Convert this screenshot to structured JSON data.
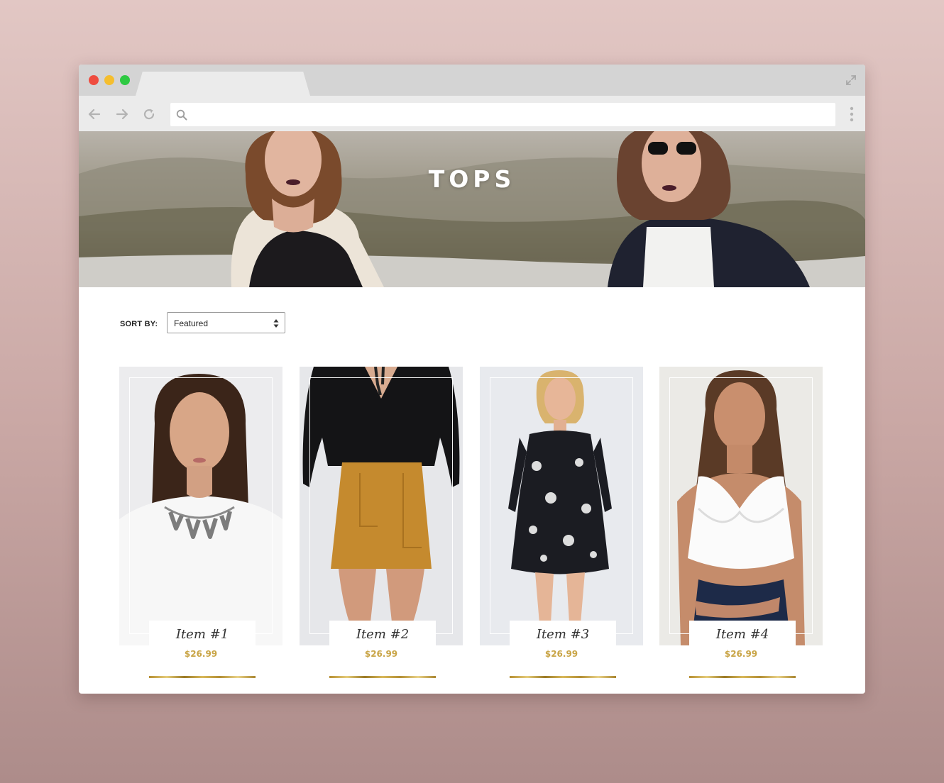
{
  "browser": {
    "traffic_lights": {
      "close": "#ef4c3f",
      "minimize": "#f5be2e",
      "maximize": "#2ec942"
    },
    "address": {
      "value": "",
      "placeholder": ""
    }
  },
  "hero": {
    "title": "TOPS"
  },
  "sort": {
    "label": "SORT BY:",
    "selected": "Featured"
  },
  "products": [
    {
      "name": "Item #1",
      "price": "$26.99"
    },
    {
      "name": "Item #2",
      "price": "$26.99"
    },
    {
      "name": "Item #3",
      "price": "$26.99"
    },
    {
      "name": "Item #4",
      "price": "$26.99"
    }
  ],
  "colors": {
    "price": "#c9a547",
    "gold_accent": "#d4b15a"
  }
}
